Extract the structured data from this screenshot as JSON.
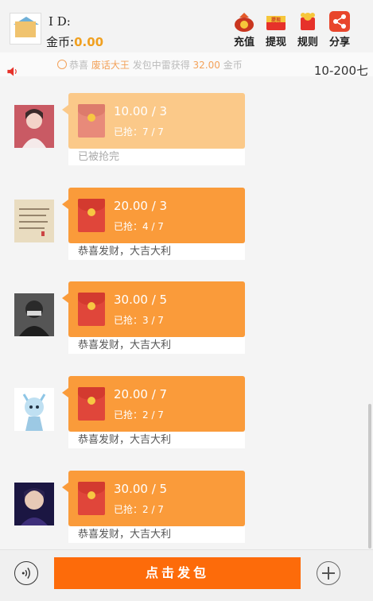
{
  "header": {
    "id_label": "I D:",
    "coin_label": "金币:",
    "coin_value": "0.00",
    "buttons": [
      {
        "label": "充值",
        "icon": "money-bag-icon"
      },
      {
        "label": "提现",
        "icon": "withdraw-icon",
        "icon_text": "提现"
      },
      {
        "label": "规则",
        "icon": "rules-icon"
      },
      {
        "label": "分享",
        "icon": "share-icon"
      }
    ]
  },
  "notice": {
    "prefix": "恭喜",
    "user": "废话大王",
    "middle": "发包中雷获得",
    "amount": "32.00",
    "suffix": "金币",
    "range": "10-200七"
  },
  "packets": [
    {
      "amount": "10.00 / 3",
      "grab": "已抢：7 / 7",
      "wish": "已被抢完",
      "status": "done"
    },
    {
      "amount": "20.00 / 3",
      "grab": "已抢：4 / 7",
      "wish": "恭喜发财，大吉大利",
      "status": "active"
    },
    {
      "amount": "30.00 / 5",
      "grab": "已抢：3 / 7",
      "wish": "恭喜发财，大吉大利",
      "status": "active"
    },
    {
      "amount": "20.00 / 7",
      "grab": "已抢：2 / 7",
      "wish": "恭喜发财，大吉大利",
      "status": "active"
    },
    {
      "amount": "30.00 / 5",
      "grab": "已抢：2 / 7",
      "wish": "恭喜发财，大吉大利",
      "status": "active"
    }
  ],
  "bottom": {
    "send_label": "点击发包"
  },
  "colors": {
    "accent": "#fd6b0a",
    "bubble": "#fa9b3a",
    "bubble_done": "#fbc989",
    "coin": "#f0a020"
  }
}
